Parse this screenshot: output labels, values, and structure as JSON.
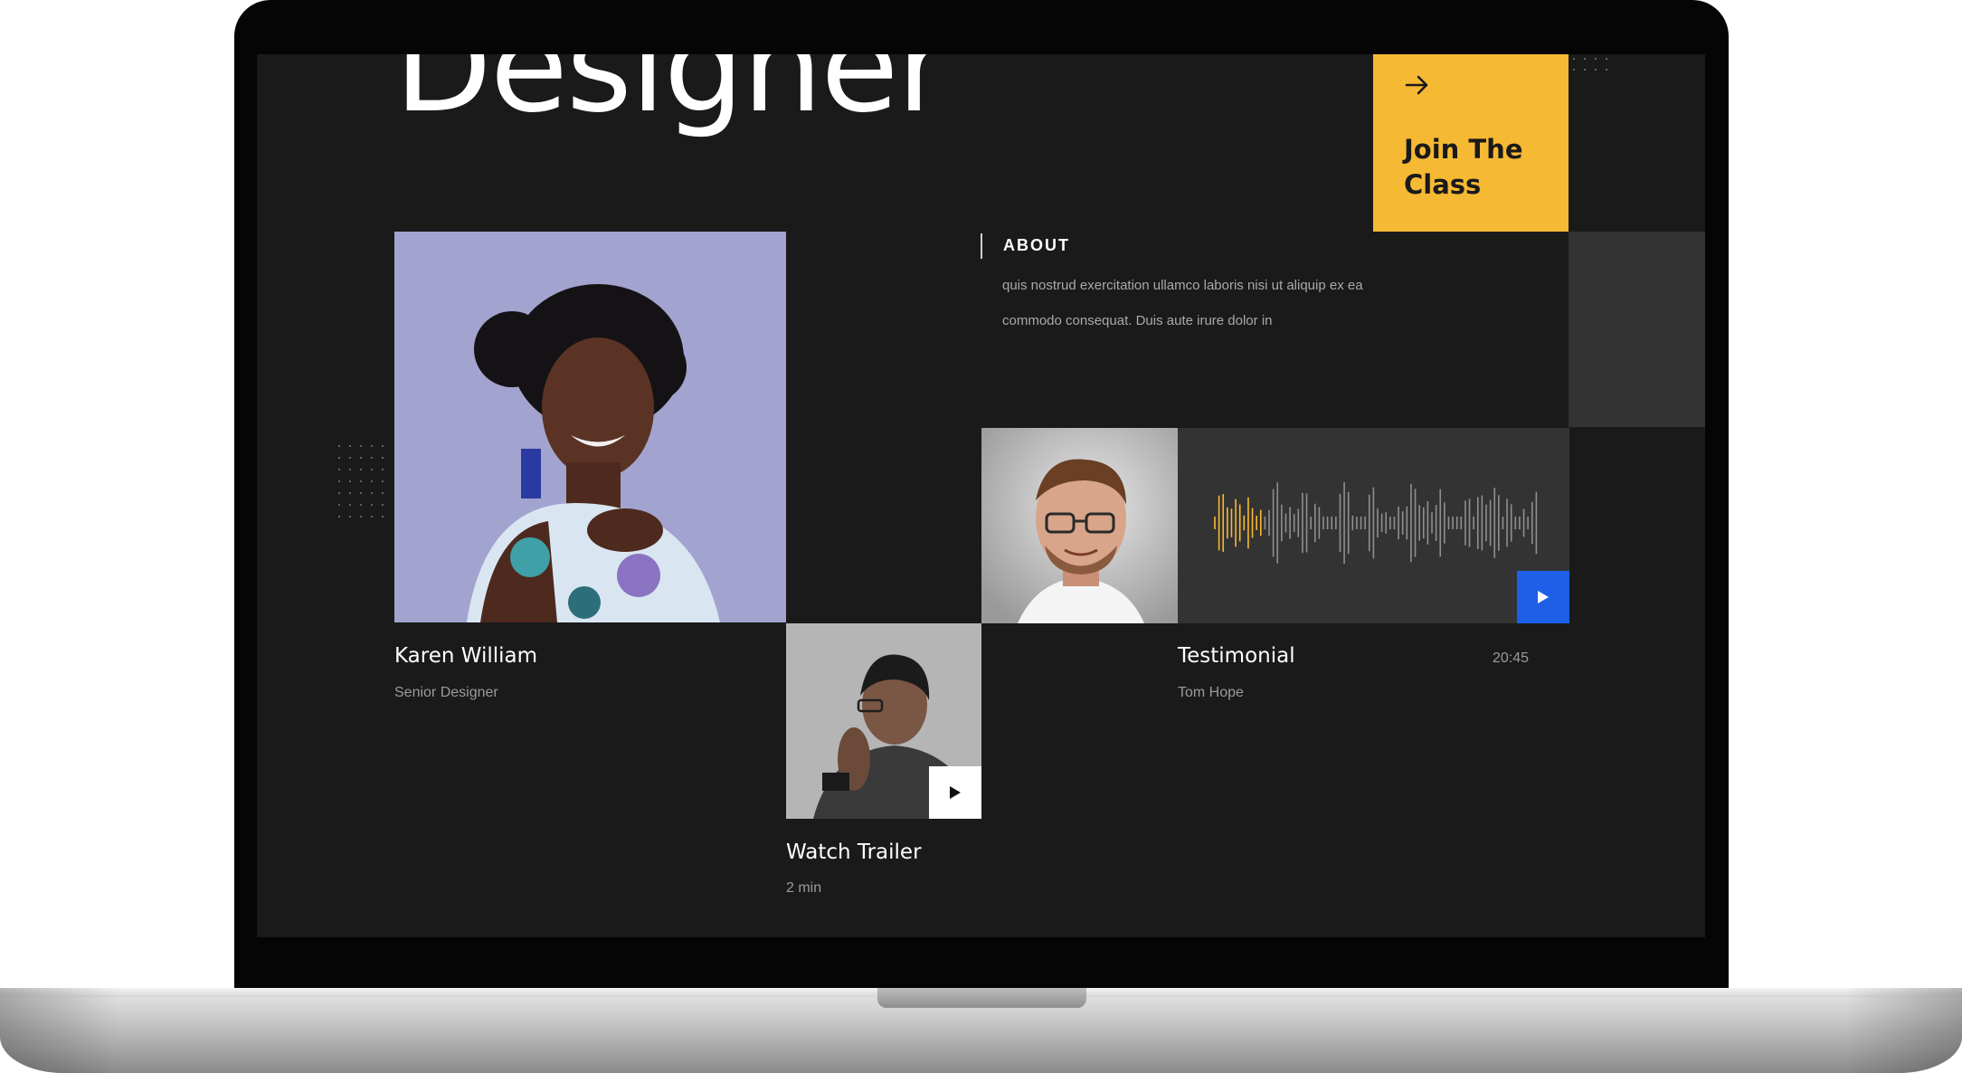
{
  "hero": {
    "title": "Designer"
  },
  "join_card": {
    "label": "Join The Class",
    "icon": "arrow-right-icon",
    "color": "#f6b933"
  },
  "about": {
    "title": "ABOUT",
    "text": "quis nostrud exercitation ullamco laboris nisi ut aliquip ex ea commodo consequat. Duis aute irure dolor in"
  },
  "karen": {
    "name": "Karen William",
    "role": "Senior Designer"
  },
  "testimonial": {
    "title": "Testimonial",
    "author": "Tom Hope",
    "duration": "20:45",
    "play_icon": "play-icon",
    "accent": "#1d5fe6",
    "wave_accent": "#f6b933"
  },
  "trailer": {
    "title": "Watch Trailer",
    "duration": "2 min",
    "play_icon": "play-icon"
  }
}
